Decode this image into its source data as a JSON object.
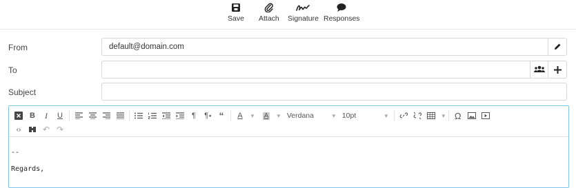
{
  "toolbar": {
    "save_label": "Save",
    "attach_label": "Attach",
    "signature_label": "Signature",
    "responses_label": "Responses"
  },
  "form": {
    "from_label": "From",
    "from_value": "default@domain.com",
    "to_label": "To",
    "to_value": "",
    "subject_label": "Subject",
    "subject_value": ""
  },
  "editor": {
    "font_family": "Verdana",
    "font_size": "10pt",
    "body_lines": [
      "--",
      "Regards,"
    ],
    "icons_row1": [
      "source-toggle-icon",
      "bold-icon",
      "italic-icon",
      "underline-icon",
      "align-left-icon",
      "align-center-icon",
      "align-right-icon",
      "align-justify-icon",
      "bullet-list-icon",
      "numbered-list-icon",
      "outdent-icon",
      "indent-icon",
      "ltr-icon",
      "rtl-icon",
      "blockquote-icon",
      "text-color-icon",
      "background-color-icon",
      "font-family-select",
      "font-size-select",
      "link-icon",
      "unlink-icon",
      "table-icon",
      "special-char-icon",
      "image-icon",
      "media-icon"
    ],
    "icons_row2": [
      "code-icon",
      "search-replace-icon",
      "undo-icon",
      "redo-icon"
    ]
  },
  "colors": {
    "accent_border": "#7fc3ea",
    "field_border": "#d7d7d7"
  }
}
